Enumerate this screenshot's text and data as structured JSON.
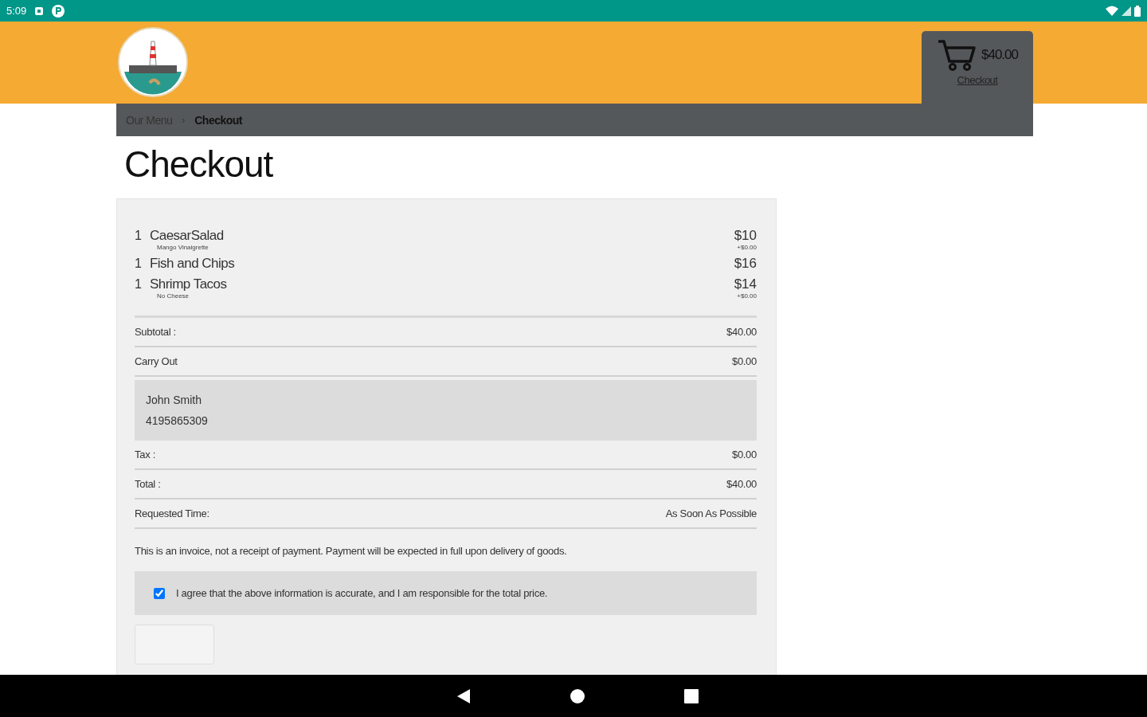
{
  "status_bar": {
    "time": "5:09"
  },
  "cart": {
    "total": "$40.00",
    "link": "Checkout"
  },
  "breadcrumb": {
    "separator": "›",
    "items": [
      {
        "label": "Our Menu",
        "current": false
      },
      {
        "label": "Checkout",
        "current": true
      }
    ]
  },
  "page_title": "Checkout",
  "items": [
    {
      "qty": "1",
      "name": "CaesarSalad",
      "option": "Mango Vinaigrette",
      "price": "$10",
      "option_price": "+$0.00"
    },
    {
      "qty": "1",
      "name": "Fish and Chips",
      "price": "$16"
    },
    {
      "qty": "1",
      "name": "Shrimp Tacos",
      "option": "No Cheese",
      "price": "$14",
      "option_price": "+$0.00"
    }
  ],
  "summary": [
    {
      "kind": "row",
      "label": "Subtotal :",
      "value": "$40.00"
    },
    {
      "kind": "row",
      "label": "Carry Out",
      "value": "$0.00"
    },
    {
      "kind": "contact",
      "lines": [
        "John Smith",
        "4195865309"
      ]
    },
    {
      "kind": "row",
      "label": "Tax :",
      "value": "$0.00"
    },
    {
      "kind": "row",
      "label": "Total :",
      "value": "$40.00"
    },
    {
      "kind": "row",
      "label": "Requested Time:",
      "value": "As Soon As Possible"
    }
  ],
  "notice": "This is an invoice, not a receipt of payment. Payment will be expected in full upon delivery of goods.",
  "agreement": {
    "label": "I agree that the above information is accurate, and I am responsible for the total price.",
    "checked": true
  }
}
